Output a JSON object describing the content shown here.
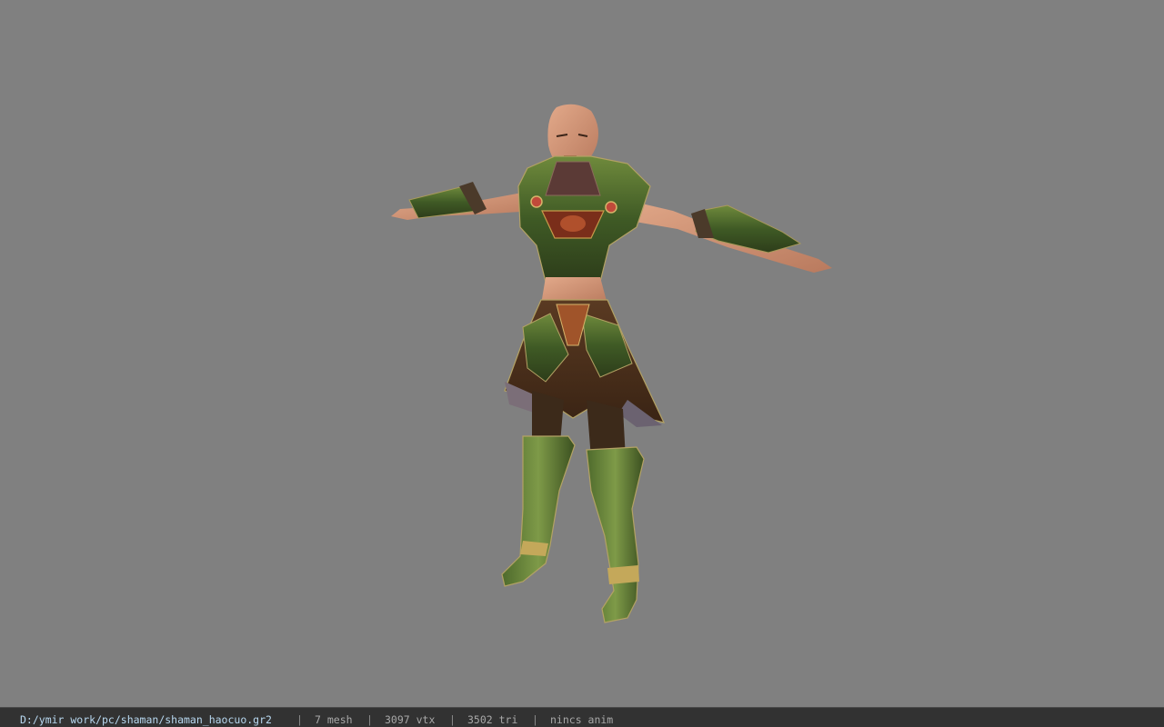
{
  "viewport": {
    "background": "#808080",
    "model_name": "shaman_haocuo"
  },
  "statusbar": {
    "file_path": "D:/ymir work/pc/shaman/shaman_haocuo.gr2",
    "separator": "|",
    "mesh_count": "7 mesh",
    "vertex_count": "3097 vtx",
    "triangle_count": "3502 tri",
    "animation": "nincs anim"
  },
  "colors": {
    "statusbar_bg": "#323232",
    "path_text": "#b8d8f0",
    "info_text": "#a8a8a8"
  }
}
